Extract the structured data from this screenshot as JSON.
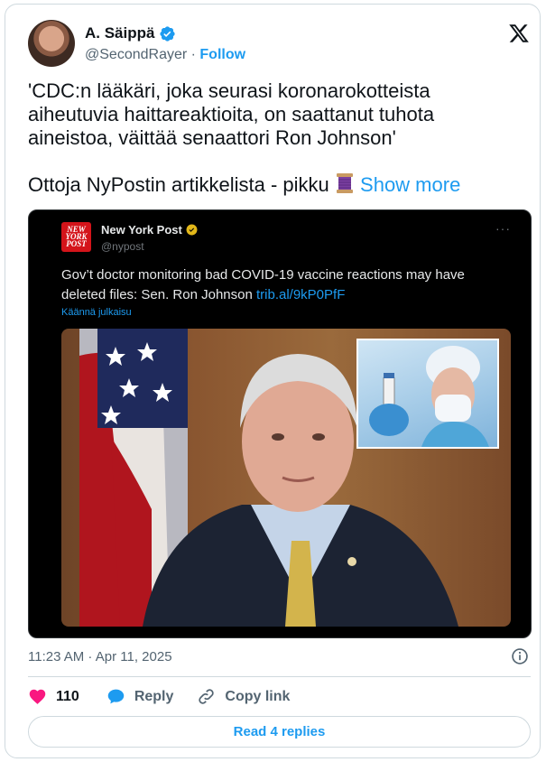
{
  "author": {
    "display_name": "A. Säippä",
    "handle": "@SecondRayer",
    "separator": " · ",
    "follow_label": "Follow"
  },
  "tweet": {
    "text_line1": "'CDC:n lääkäri, joka seurasi koronarokotteista aiheutuvia haittareaktioita, on saattanut tuhota aineistoa, väittää senaattori Ron Johnson'",
    "text_line2": "Ottoja NyPostin artikkelista - pikku",
    "show_more_label": "Show more",
    "timestamp": "11:23 AM · Apr 11, 2025"
  },
  "quoted": {
    "logo_text": "NEW YORK POST",
    "name": "New York Post",
    "handle": "@nypost",
    "more": "···",
    "text": "Gov’t doctor monitoring bad COVID-19 vaccine reactions may have deleted files: Sen. Ron Johnson ",
    "link": "trib.al/9kP0PfF",
    "translate_label": "Käännä julkaisu"
  },
  "actions": {
    "likes_count": "110",
    "reply_label": "Reply",
    "copy_link_label": "Copy link",
    "read_replies_label": "Read 4 replies"
  },
  "colors": {
    "accent": "#1d9bf0",
    "like": "#f91880",
    "text": "#0f1419",
    "muted": "#536471"
  }
}
